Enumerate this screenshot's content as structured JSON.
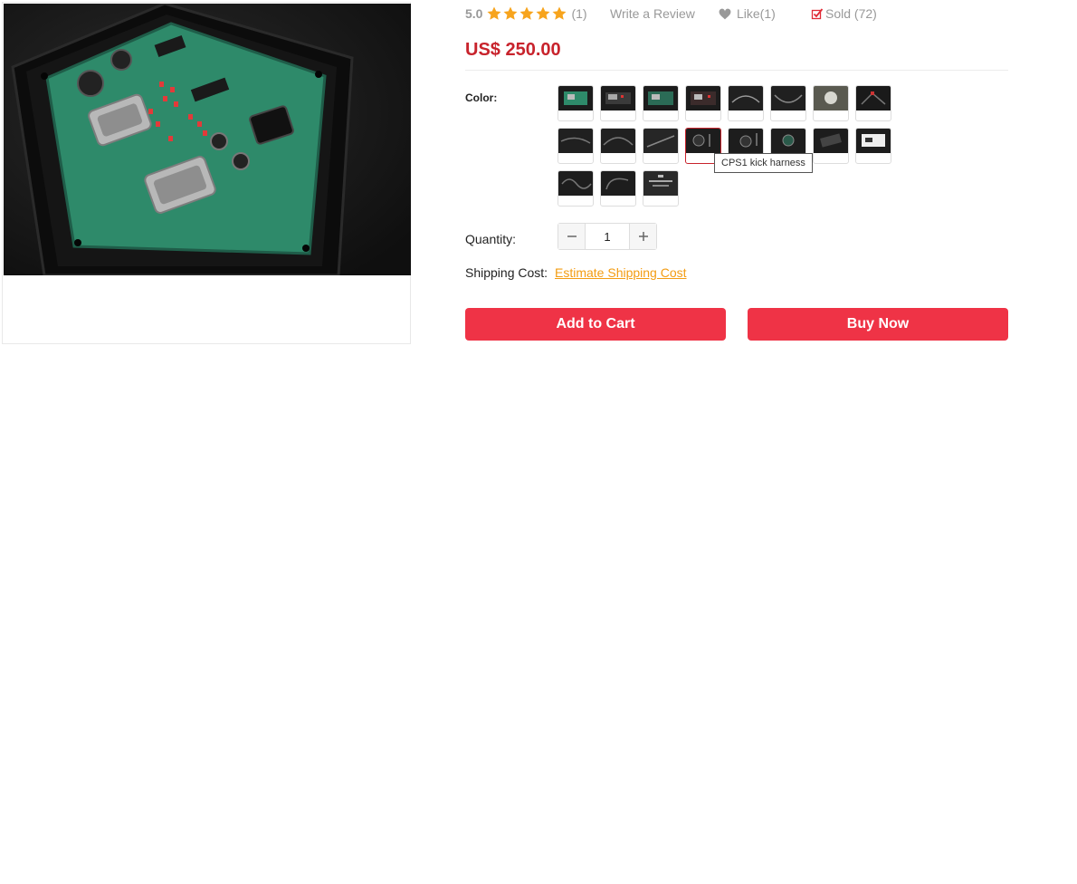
{
  "rating": {
    "score": "5.0",
    "stars_filled": 5,
    "stars_total": 5,
    "review_count": "(1)",
    "write_review": "Write a Review",
    "like_label": "Like(1)",
    "sold_label": "Sold (72)",
    "star_icon": "star-icon",
    "heart_icon": "heart-icon",
    "check_icon": "checkbox-check-icon"
  },
  "price": "US$ 250.00",
  "color": {
    "label": "Color:",
    "tooltip": "CPS1 kick harness",
    "selected_index": 11,
    "option_count": 19
  },
  "quantity": {
    "label": "Quantity:",
    "value": "1",
    "minus_icon": "minus-icon",
    "plus_icon": "plus-icon"
  },
  "shipping": {
    "label": "Shipping Cost:",
    "link": "Estimate Shipping Cost"
  },
  "buttons": {
    "add_to_cart": "Add to Cart",
    "buy_now": "Buy Now"
  },
  "colors": {
    "price": "#c8232c",
    "cta": "#ef3346",
    "star": "#f7a41d",
    "link": "#f39c12",
    "check": "#e02b36"
  }
}
